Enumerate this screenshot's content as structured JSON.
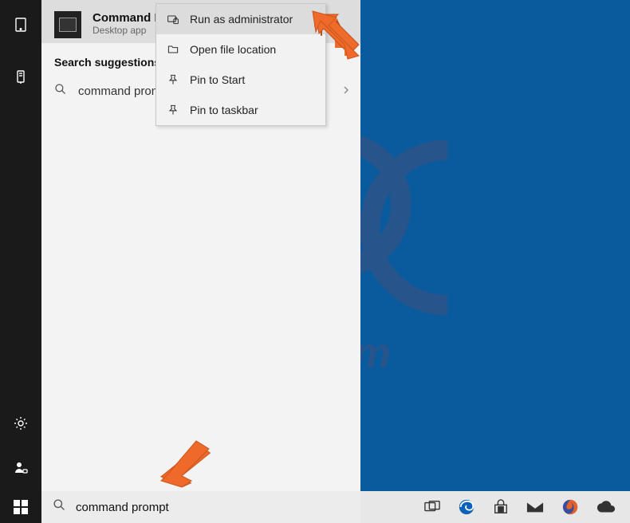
{
  "best_match": {
    "title": "Command Prompt",
    "subtitle": "Desktop app"
  },
  "section_label": "Search suggestions",
  "suggestion": {
    "text": "command prompt"
  },
  "context_menu": {
    "items": [
      {
        "label": "Run as administrator"
      },
      {
        "label": "Open file location"
      },
      {
        "label": "Pin to Start"
      },
      {
        "label": "Pin to taskbar"
      }
    ]
  },
  "search": {
    "value": "command prompt"
  }
}
